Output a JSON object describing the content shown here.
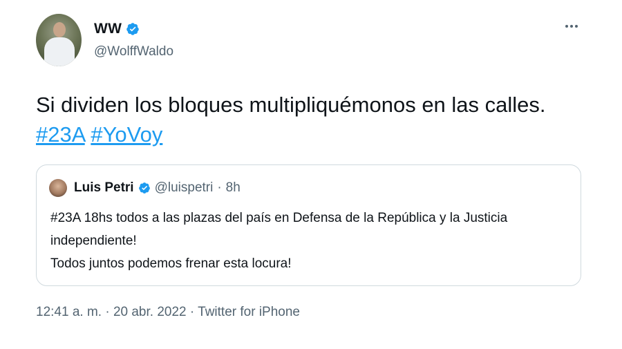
{
  "author": {
    "display_name": "WW",
    "handle": "@WolffWaldo"
  },
  "tweet": {
    "text_line1": "Si dividen los bloques multipliquémonos en las calles.",
    "hashtags": [
      "#23A",
      "#YoVoy"
    ]
  },
  "quoted_tweet": {
    "name": "Luis Petri",
    "handle": "@luispetri",
    "separator": "·",
    "time": "8h",
    "lines": [
      "#23A 18hs todos a las plazas del país en Defensa de la República y la Justicia",
      "independiente!",
      "Todos juntos podemos frenar esta locura!"
    ]
  },
  "footer": {
    "time": "12:41 a. m.",
    "date": "20 abr. 2022",
    "source": "Twitter for iPhone",
    "separator": "·"
  },
  "colors": {
    "accent": "#1d9bf0",
    "text": "#0f1419",
    "secondary": "#536471",
    "border": "#cfd9de"
  },
  "icons": {
    "verified": "verified-badge-icon",
    "more": "more-options-icon"
  }
}
